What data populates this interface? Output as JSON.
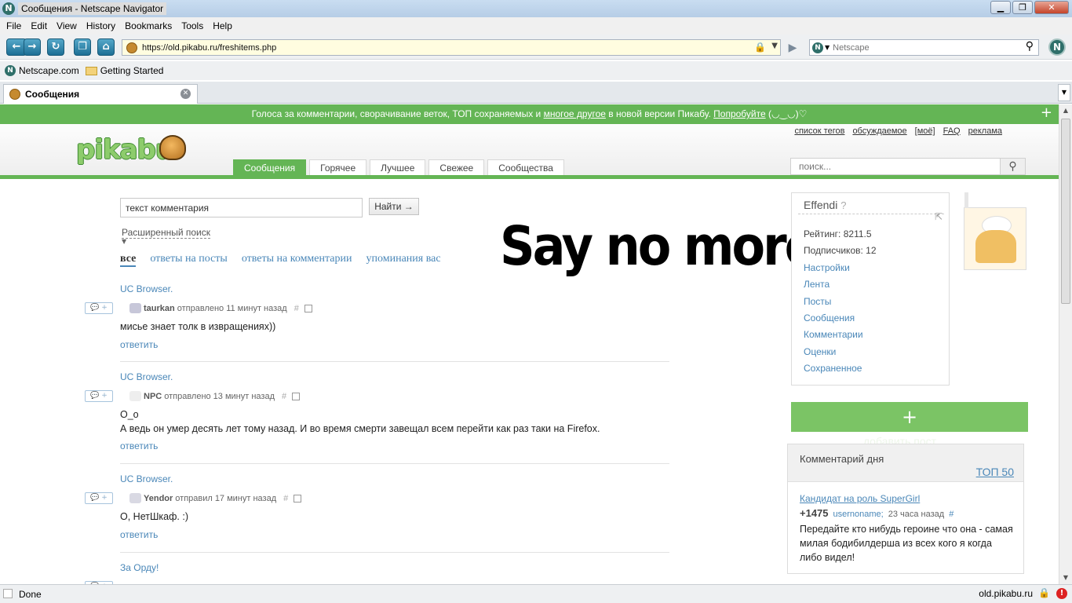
{
  "window": {
    "title": "Сообщения - Netscape Navigator",
    "app_icon": "N",
    "min": "▁",
    "max": "❐",
    "close": "✕"
  },
  "menu": [
    "File",
    "Edit",
    "View",
    "History",
    "Bookmarks",
    "Tools",
    "Help"
  ],
  "nav": {
    "url": "https://old.pikabu.ru/freshitems.php",
    "search_placeholder": "Netscape",
    "engine_icon": "N"
  },
  "bookmarks": [
    {
      "label": "Netscape.com",
      "icon": "netscape-icon"
    },
    {
      "label": "Getting Started",
      "icon": "folder-icon"
    }
  ],
  "tab": {
    "title": "Сообщения"
  },
  "notice": {
    "prefix": "Голоса за комментарии, сворачивание веток, ТОП сохраняемых и ",
    "link1": "многое другое",
    "middle": " в новой версии Пикабу. ",
    "link2": "Попробуйте",
    "suffix": " (◡‿◡)♡",
    "close": "+"
  },
  "site": {
    "logo": "pikabu",
    "toplinks": [
      "список тегов",
      "обсуждаемое",
      "[моё]",
      "FAQ",
      "реклама"
    ],
    "navtabs": [
      "Сообщения",
      "Горячее",
      "Лучшее",
      "Свежее",
      "Сообщества"
    ],
    "search_placeholder": "поиск..."
  },
  "comments_search": {
    "value": "текст комментария",
    "button": "Найти →",
    "advanced": "Расширенный поиск"
  },
  "filters": [
    "все",
    "ответы на посты",
    "ответы на комментарии",
    "упоминания вас"
  ],
  "meme_text": "Say no more",
  "comments": [
    {
      "post": "UC Browser.",
      "author": "taurkan",
      "action": "отправлено",
      "time": "11 минут назад",
      "lines": [
        "мисье знает толк в извращениях))"
      ],
      "reply": "ответить"
    },
    {
      "post": "UC Browser.",
      "author": "NPC",
      "action": "отправлено",
      "time": "13 минут назад",
      "lines": [
        "О_о",
        "А ведь он умер десять лет тому назад. И во время смерти завещал всем перейти как раз таки на Firefox."
      ],
      "reply": "ответить"
    },
    {
      "post": "UC Browser.",
      "author": "Yendor",
      "action": "отправил",
      "time": "17 минут назад",
      "lines": [
        "О, НетШкаф. :)"
      ],
      "reply": "ответить"
    },
    {
      "post": "За Орду!"
    }
  ],
  "reply_box": "💬 +",
  "user": {
    "name": "Effendi",
    "help": "?",
    "rating": "Рейтинг: 8211.5",
    "subscribers": "Подписчиков: 12",
    "links": [
      "Настройки",
      "Лента",
      "Посты",
      "Сообщения",
      "Комментарии",
      "Оценки",
      "Сохраненное"
    ]
  },
  "add_post": {
    "plus": "+",
    "label": "добавить пост"
  },
  "comment_of_day": {
    "title": "Комментарий дня",
    "top": "ТОП 50",
    "post": "Кандидат на роль SuperGirl",
    "rating": "+1475",
    "user": "usernoname;",
    "time": "23 часа назад",
    "hash": "#",
    "text": "Передайте кто нибудь героине что она - самая милая бодибилдерша из всех кого я когда либо видел!"
  },
  "status": {
    "text": "Done",
    "host": "old.pikabu.ru"
  }
}
